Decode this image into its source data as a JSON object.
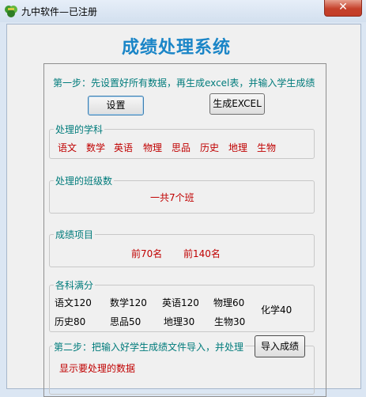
{
  "window": {
    "title": "九中软件—已注册",
    "close_symbol": "✕"
  },
  "app_title": "成绩处理系统",
  "step1": {
    "text": "第一步：先设置好所有数据，再生成excel表，并输入学生成绩",
    "settings_button": "设置",
    "generate_button": "生成EXCEL"
  },
  "subjects_group": {
    "legend": "处理的学科",
    "items": [
      "语文",
      "数学",
      "英语",
      "物理",
      "思品",
      "历史",
      "地理",
      "生物"
    ]
  },
  "classes_group": {
    "legend": "处理的班级数",
    "value": "一共7个班"
  },
  "items_group": {
    "legend": "成绩项目",
    "top70": "前70名",
    "top140": "前140名"
  },
  "fullmarks_group": {
    "legend": "各科满分",
    "row1": [
      "语文120",
      "数学120",
      "英语120",
      "物理60"
    ],
    "chemistry": "化学40",
    "row2": [
      "历史80",
      "思品50",
      "地理30",
      "生物30"
    ]
  },
  "step2": {
    "text": "第二步：把输入好学生成绩文件导入，并处理",
    "import_button": "导入成绩",
    "status": "显示要处理的数据"
  },
  "colors": {
    "accent": "#1a85c7",
    "teal": "#007b7b",
    "red": "#c00000"
  }
}
